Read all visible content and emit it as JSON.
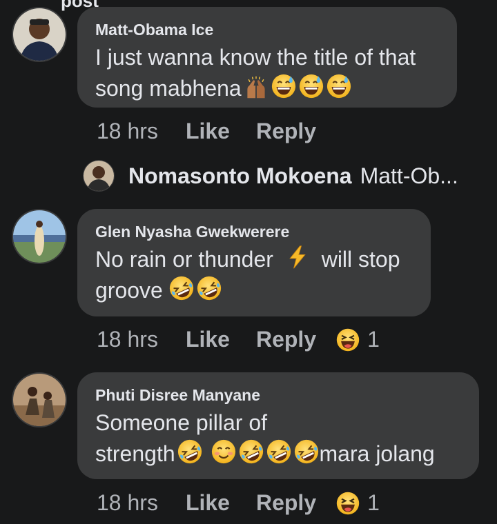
{
  "page_fragment": "post",
  "comments": [
    {
      "author": "Matt-Obama Ice",
      "text_line1": "I just wanna know the title of that",
      "text_line2": "song mabhena",
      "time": "18 hrs",
      "like": "Like",
      "reply": "Reply",
      "reply_preview": {
        "author": "Nomasonto Mokoena",
        "text": "Matt-Ob..."
      }
    },
    {
      "author": "Glen Nyasha Gwekwerere",
      "text_line1a": "No rain or thunder",
      "text_line1b": "will stop",
      "text_line2": "groove",
      "time": "18 hrs",
      "like": "Like",
      "reply": "Reply",
      "reaction_count": "1"
    },
    {
      "author": "Phuti Disree Manyane",
      "text_line1": "Someone pillar of",
      "text_line2a": "strength",
      "text_line2b": "mara jolang",
      "time": "18 hrs",
      "like": "Like",
      "reply": "Reply",
      "reaction_count": "1"
    }
  ],
  "icons": {
    "raising_hands": "raising-hands-emoji",
    "sweat_smile": "grinning-sweat-emoji",
    "rofl": "rolling-laughing-emoji",
    "blush": "smiling-blush-emoji",
    "zap": "lightning-emoji",
    "haha": "haha-reaction-icon"
  },
  "colors": {
    "background": "#18191a",
    "bubble": "#3a3b3c",
    "text": "#e4e6eb",
    "secondary": "#b0b3b8"
  }
}
